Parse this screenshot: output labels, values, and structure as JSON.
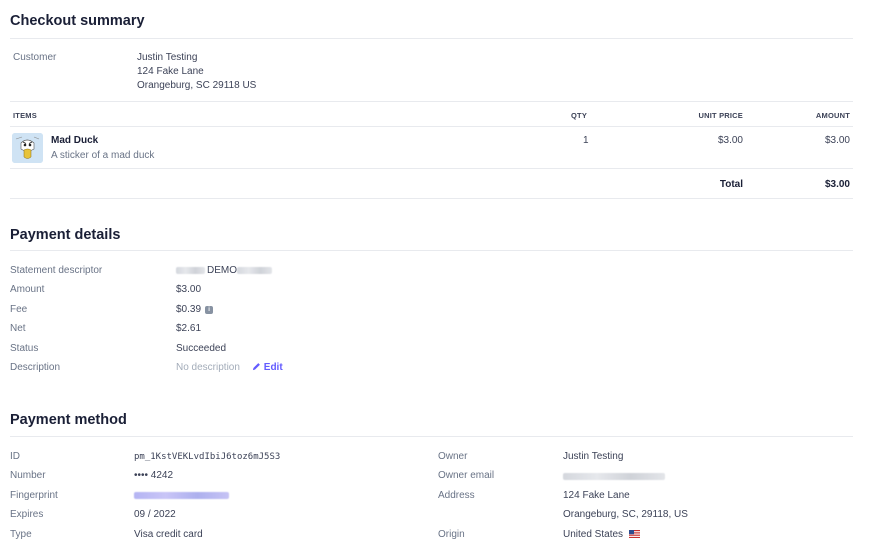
{
  "checkout": {
    "title": "Checkout summary",
    "customer_label": "Customer",
    "customer": {
      "name": "Justin Testing",
      "line1": "124 Fake Lane",
      "line2": "Orangeburg, SC 29118 US"
    },
    "columns": {
      "items": "ITEMS",
      "qty": "QTY",
      "unit_price": "UNIT PRICE",
      "amount": "AMOUNT"
    },
    "items": [
      {
        "name": "Mad Duck",
        "description": "A sticker of a mad duck",
        "qty": "1",
        "unit_price": "$3.00",
        "amount": "$3.00"
      }
    ],
    "total_label": "Total",
    "total": "$3.00"
  },
  "payment_details": {
    "title": "Payment details",
    "statement_descriptor_label": "Statement descriptor",
    "statement_descriptor_visible": "DEMO",
    "amount_label": "Amount",
    "amount": "$3.00",
    "fee_label": "Fee",
    "fee": "$0.39",
    "net_label": "Net",
    "net": "$2.61",
    "status_label": "Status",
    "status": "Succeeded",
    "description_label": "Description",
    "description_placeholder": "No description",
    "edit_label": "Edit"
  },
  "payment_method": {
    "title": "Payment method",
    "id_label": "ID",
    "id": "pm_1KstVEKLvdIbiJ6toz6mJ5S3",
    "number_label": "Number",
    "number": "•••• 4242",
    "fingerprint_label": "Fingerprint",
    "expires_label": "Expires",
    "expires": "09 / 2022",
    "type_label": "Type",
    "type": "Visa credit card",
    "owner_label": "Owner",
    "owner": "Justin Testing",
    "owner_email_label": "Owner email",
    "address_label": "Address",
    "address_line1": "124 Fake Lane",
    "address_line2": "Orangeburg, SC, 29118, US",
    "origin_label": "Origin",
    "origin": "United States"
  },
  "colors": {
    "heading": "#1a1f36",
    "text": "#3c4257",
    "label": "#697386",
    "muted": "#a3acb9",
    "link": "#635bff",
    "divider": "#e8eaee"
  },
  "icons": [
    "info-icon",
    "pencil-icon",
    "us-flag-icon",
    "duck-sticker-image"
  ]
}
